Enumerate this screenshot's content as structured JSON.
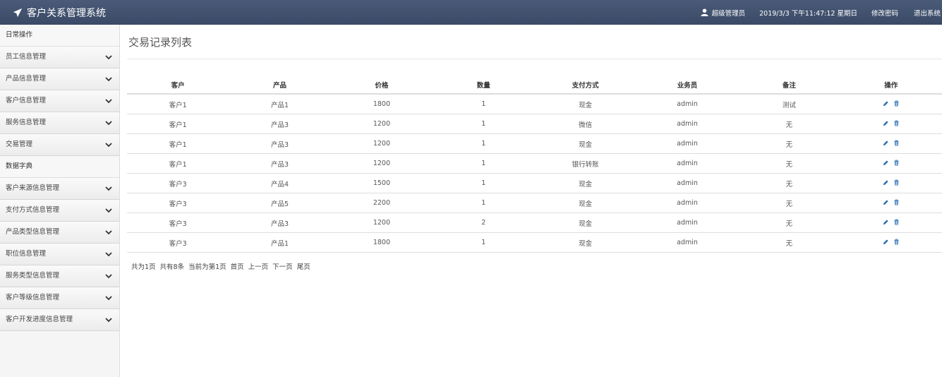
{
  "header": {
    "title": "客户关系管理系统",
    "user": "超级管理员",
    "datetime": "2019/3/3 下午11:47:12 星期日",
    "change_password": "修改密码",
    "logout": "退出系统"
  },
  "sidebar": {
    "sections": [
      {
        "title": "日常操作",
        "items": [
          "员工信息管理",
          "产品信息管理",
          "客户信息管理",
          "服务信息管理",
          "交易管理"
        ]
      },
      {
        "title": "数据字典",
        "items": [
          "客户来源信息管理",
          "支付方式信息管理",
          "产品类型信息管理",
          "职位信息管理",
          "服务类型信息管理",
          "客户等级信息管理",
          "客户开发进度信息管理"
        ]
      }
    ]
  },
  "main": {
    "title": "交易记录列表",
    "table": {
      "headers": [
        "客户",
        "产品",
        "价格",
        "数量",
        "支付方式",
        "业务员",
        "备注",
        "操作"
      ],
      "rows": [
        [
          "客户1",
          "产品1",
          "1800",
          "1",
          "现金",
          "admin",
          "测试"
        ],
        [
          "客户1",
          "产品3",
          "1200",
          "1",
          "微信",
          "admin",
          "无"
        ],
        [
          "客户1",
          "产品3",
          "1200",
          "1",
          "现金",
          "admin",
          "无"
        ],
        [
          "客户1",
          "产品3",
          "1200",
          "1",
          "银行转账",
          "admin",
          "无"
        ],
        [
          "客户3",
          "产品4",
          "1500",
          "1",
          "现金",
          "admin",
          "无"
        ],
        [
          "客户3",
          "产品5",
          "2200",
          "1",
          "现金",
          "admin",
          "无"
        ],
        [
          "客户3",
          "产品3",
          "1200",
          "2",
          "现金",
          "admin",
          "无"
        ],
        [
          "客户3",
          "产品1",
          "1800",
          "1",
          "现金",
          "admin",
          "无"
        ]
      ]
    },
    "pagination": {
      "total_pages": "共为1页",
      "total_records": "共有8条",
      "current": "当前为第1页",
      "first": "首页",
      "prev": "上一页",
      "next": "下一页",
      "last": "尾页"
    }
  },
  "icons": {
    "brand": "paper-plane-icon",
    "user": "user-icon",
    "expand": "chevron-down-icon",
    "edit": "pencil-icon",
    "delete": "trash-icon"
  },
  "colors": {
    "header_bg": "#3f4f6b",
    "icon_blue": "#2a6fb5"
  }
}
